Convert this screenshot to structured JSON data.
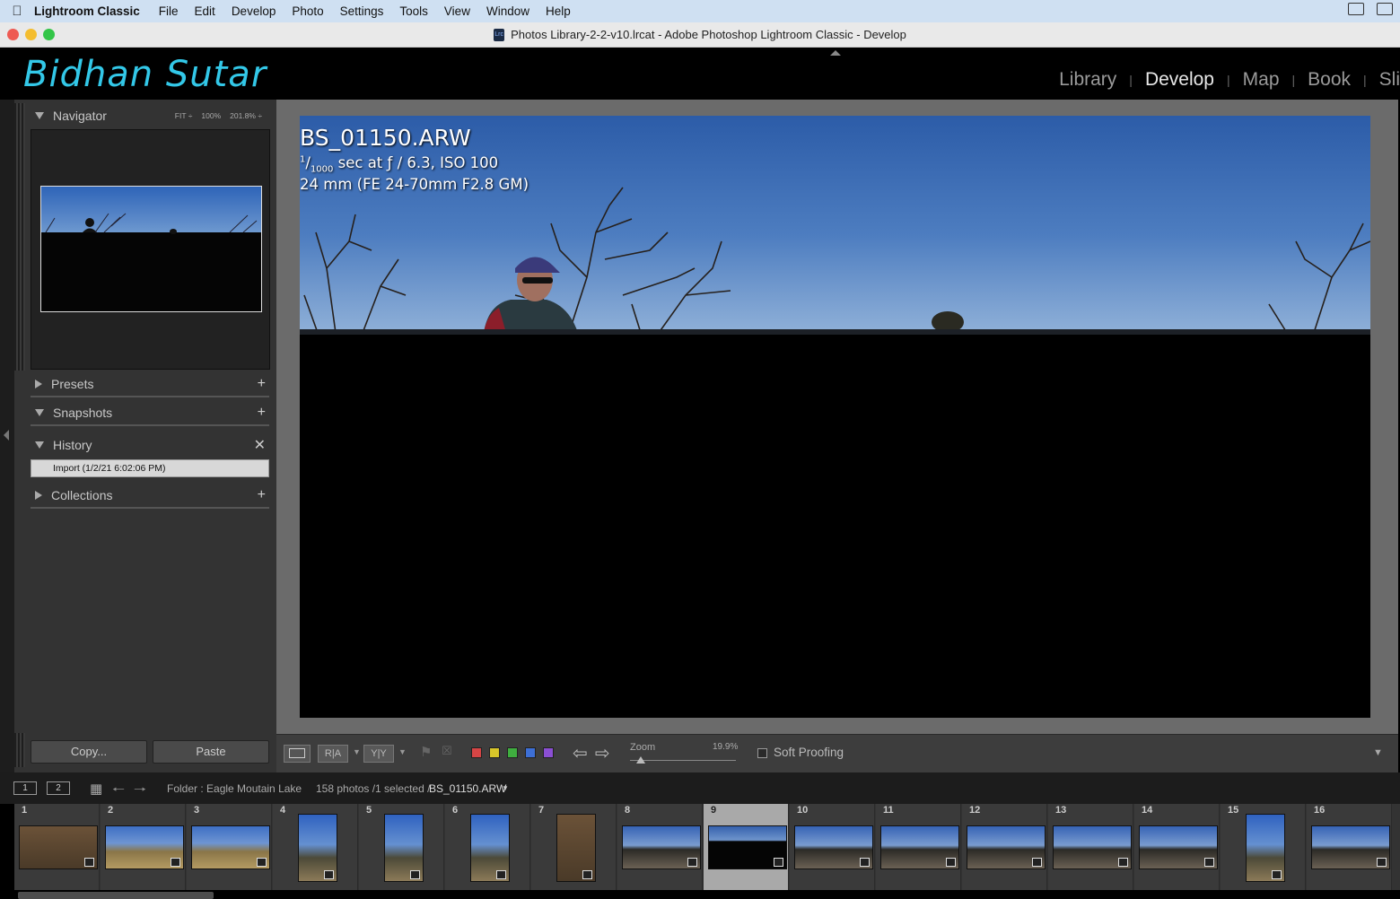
{
  "menubar": {
    "app": "Lightroom Classic",
    "items": [
      "File",
      "Edit",
      "Develop",
      "Photo",
      "Settings",
      "Tools",
      "View",
      "Window",
      "Help"
    ]
  },
  "window": {
    "title": "Photos Library-2-2-v10.lrcat - Adobe Photoshop Lightroom Classic - Develop"
  },
  "identity_plate": "Bidhan Sutar",
  "modules": {
    "library": "Library",
    "develop": "Develop",
    "map": "Map",
    "book": "Book",
    "slideshow_partial": "Sli",
    "active": "Develop"
  },
  "left_panel": {
    "navigator": {
      "title": "Navigator",
      "zoom_fit": "FIT ÷",
      "zoom_100": "100%",
      "zoom_other": "201.8% ÷"
    },
    "presets": {
      "title": "Presets"
    },
    "snapshots": {
      "title": "Snapshots"
    },
    "history": {
      "title": "History",
      "items": [
        "Import (1/2/21 6:02:06 PM)"
      ]
    },
    "collections": {
      "title": "Collections"
    },
    "copy_button": "Copy...",
    "paste_button": "Paste"
  },
  "photo_info": {
    "filename": "BS_01150.ARW",
    "shutter_numerator": "1",
    "shutter_denominator": "1000",
    "exposure_rest": " sec at ƒ / 6.3, ISO 100",
    "lens": "24 mm (FE 24-70mm F2.8 GM)"
  },
  "toolbar": {
    "before_after_1": "R|A",
    "before_after_2": "Y|Y",
    "color_labels": [
      "#d64545",
      "#d8c62a",
      "#3fae3f",
      "#3d6fd6",
      "#8b4fd4"
    ],
    "zoom_label": "Zoom",
    "zoom_value": "19.9%",
    "zoom_slider_fraction": 0.1,
    "soft_proofing_label": "Soft Proofing",
    "soft_proofing_checked": false
  },
  "filmstrip_bar": {
    "monitor_1": "1",
    "monitor_2": "2",
    "folder": "Folder : Eagle Moutain Lake",
    "count": "158 photos /1 selected /",
    "selected_file": "BS_01150.ARW"
  },
  "filmstrip": {
    "selected_index": 9,
    "frames": [
      {
        "num": "1",
        "orient": "landscape",
        "tone": "brown"
      },
      {
        "num": "2",
        "orient": "landscape",
        "tone": "field"
      },
      {
        "num": "3",
        "orient": "landscape",
        "tone": "field"
      },
      {
        "num": "4",
        "orient": "portrait",
        "tone": "trail"
      },
      {
        "num": "5",
        "orient": "portrait",
        "tone": "trail"
      },
      {
        "num": "6",
        "orient": "portrait",
        "tone": "trail"
      },
      {
        "num": "7",
        "orient": "portrait",
        "tone": "brown"
      },
      {
        "num": "8",
        "orient": "landscape",
        "tone": "group"
      },
      {
        "num": "9",
        "orient": "landscape",
        "tone": "dark"
      },
      {
        "num": "10",
        "orient": "landscape",
        "tone": "group"
      },
      {
        "num": "11",
        "orient": "landscape",
        "tone": "group"
      },
      {
        "num": "12",
        "orient": "landscape",
        "tone": "group"
      },
      {
        "num": "13",
        "orient": "landscape",
        "tone": "group"
      },
      {
        "num": "14",
        "orient": "landscape",
        "tone": "group"
      },
      {
        "num": "15",
        "orient": "portrait",
        "tone": "trail"
      },
      {
        "num": "16",
        "orient": "landscape",
        "tone": "group"
      }
    ]
  }
}
